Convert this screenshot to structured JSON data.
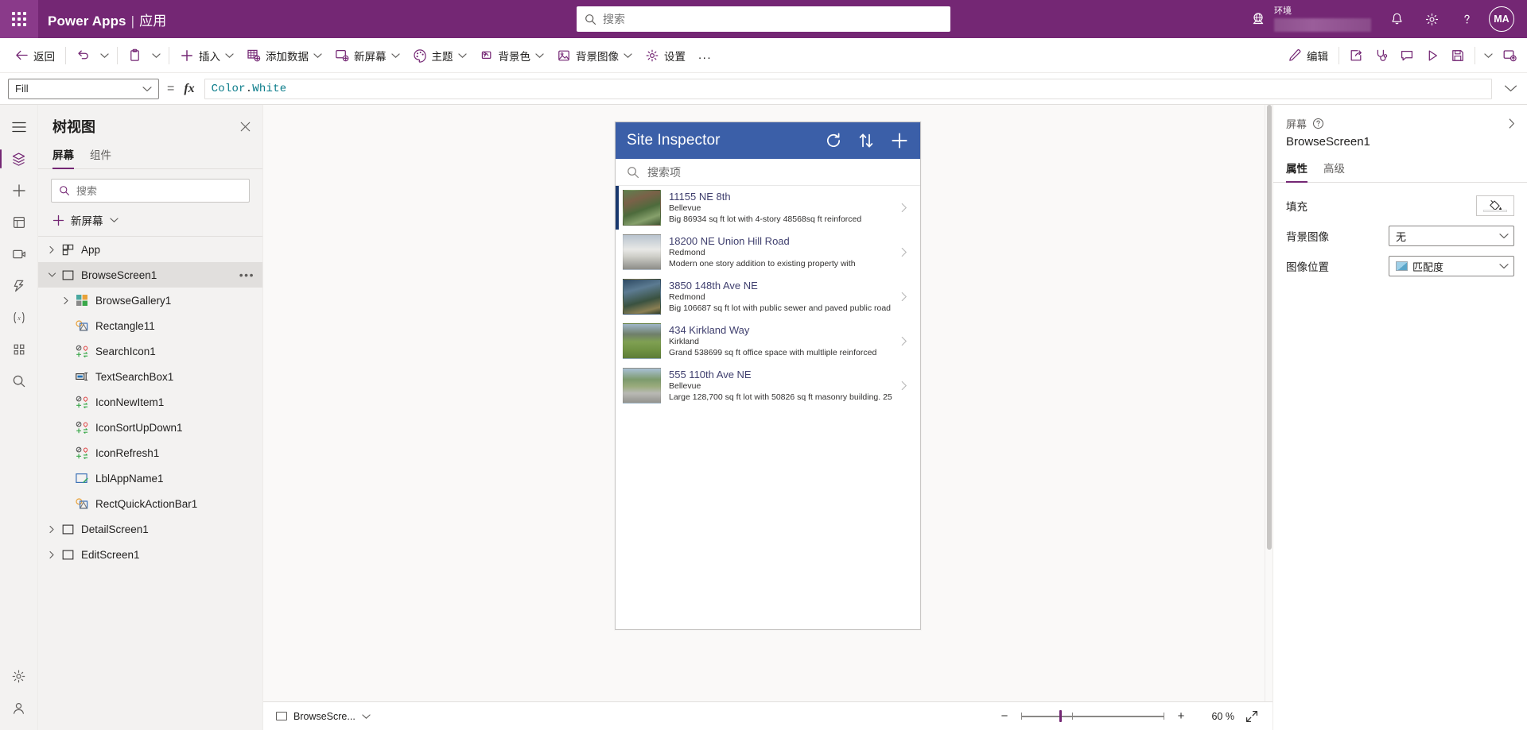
{
  "suitebar": {
    "waffle_title": "应用启动器",
    "brand": "Power Apps",
    "brand_separator": "|",
    "brand_sub": "应用",
    "search_placeholder": "搜索",
    "environment_label": "环境",
    "environment_value": "",
    "notifications_title": "通知",
    "settings_title": "设置",
    "help_title": "帮助",
    "avatar_initials": "MA",
    "accent_color": "#742774"
  },
  "ribbon": {
    "back_label": "返回",
    "undo_title": "撤消",
    "paste_title": "粘贴",
    "insert_label": "插入",
    "add_data_label": "添加数据",
    "new_screen_label": "新屏幕",
    "theme_label": "主题",
    "background_color_label": "背景色",
    "background_image_label": "背景图像",
    "settings_label": "设置",
    "more_label": "...",
    "edit_label": "编辑",
    "share_title": "共享",
    "app_checker_title": "应用检查器",
    "comments_title": "注释",
    "preview_title": "预览应用",
    "save_title": "保存",
    "publish_title": "发布"
  },
  "formulabar": {
    "property": "Fill",
    "equals": "=",
    "fx": "fx",
    "formula_object": "Color",
    "formula_dot": ".",
    "formula_member": "White",
    "expand_title": "展开公式栏"
  },
  "rail": {
    "items": [
      {
        "name": "hamburger",
        "title": "菜单"
      },
      {
        "name": "tree-view",
        "title": "树视图"
      },
      {
        "name": "insert",
        "title": "插入"
      },
      {
        "name": "data",
        "title": "数据"
      },
      {
        "name": "media",
        "title": "媒体"
      },
      {
        "name": "power-automate",
        "title": "Power Automate"
      },
      {
        "name": "variables",
        "title": "变量"
      },
      {
        "name": "components",
        "title": "组件"
      },
      {
        "name": "search",
        "title": "搜索"
      },
      {
        "name": "settings",
        "title": "设置"
      },
      {
        "name": "account",
        "title": "账户"
      }
    ]
  },
  "treepanel": {
    "title": "树视图",
    "close_title": "关闭",
    "tabs": [
      {
        "label": "屏幕",
        "active": true
      },
      {
        "label": "组件",
        "active": false
      }
    ],
    "search_placeholder": "搜索",
    "new_screen_label": "新屏幕",
    "nodes": [
      {
        "label": "App",
        "indent": 0,
        "chevron": "right",
        "icon": "app-icon",
        "selected": false,
        "more": false
      },
      {
        "label": "BrowseScreen1",
        "indent": 0,
        "chevron": "down",
        "icon": "screen-icon",
        "selected": true,
        "more": true
      },
      {
        "label": "BrowseGallery1",
        "indent": 1,
        "chevron": "right",
        "icon": "gallery-icon",
        "selected": false,
        "more": false
      },
      {
        "label": "Rectangle11",
        "indent": 1,
        "chevron": "none",
        "icon": "shape-icon",
        "selected": false,
        "more": false
      },
      {
        "label": "SearchIcon1",
        "indent": 1,
        "chevron": "none",
        "icon": "control-icon",
        "selected": false,
        "more": false
      },
      {
        "label": "TextSearchBox1",
        "indent": 1,
        "chevron": "none",
        "icon": "textinput-icon",
        "selected": false,
        "more": false
      },
      {
        "label": "IconNewItem1",
        "indent": 1,
        "chevron": "none",
        "icon": "control-icon",
        "selected": false,
        "more": false
      },
      {
        "label": "IconSortUpDown1",
        "indent": 1,
        "chevron": "none",
        "icon": "control-icon",
        "selected": false,
        "more": false
      },
      {
        "label": "IconRefresh1",
        "indent": 1,
        "chevron": "none",
        "icon": "control-icon",
        "selected": false,
        "more": false
      },
      {
        "label": "LblAppName1",
        "indent": 1,
        "chevron": "none",
        "icon": "label-icon",
        "selected": false,
        "more": false
      },
      {
        "label": "RectQuickActionBar1",
        "indent": 1,
        "chevron": "none",
        "icon": "shape-icon",
        "selected": false,
        "more": false
      },
      {
        "label": "DetailScreen1",
        "indent": 0,
        "chevron": "right",
        "icon": "screen-icon",
        "selected": false,
        "more": false
      },
      {
        "label": "EditScreen1",
        "indent": 0,
        "chevron": "right",
        "icon": "screen-icon",
        "selected": false,
        "more": false
      }
    ]
  },
  "canvas": {
    "app": {
      "header_title": "Site Inspector",
      "header_color": "#3b5fa8",
      "refresh_title": "刷新",
      "sort_title": "排序",
      "add_title": "新增",
      "search_placeholder": "搜索项",
      "items": [
        {
          "title": "11155 NE 8th",
          "city": "Bellevue",
          "description": "Big 86934 sq ft lot with 4-story 48568sq ft reinforced",
          "selected": true,
          "thumb": "t1"
        },
        {
          "title": "18200 NE Union Hill Road",
          "city": "Redmond",
          "description": "Modern one story addition to existing property with",
          "selected": false,
          "thumb": "t2"
        },
        {
          "title": "3850 148th Ave NE",
          "city": "Redmond",
          "description": "Big 106687 sq ft lot with public sewer and paved public road",
          "selected": false,
          "thumb": "t3"
        },
        {
          "title": "434 Kirkland Way",
          "city": "Kirkland",
          "description": "Grand 538699 sq ft office space with multliple reinforced",
          "selected": false,
          "thumb": "t4"
        },
        {
          "title": "555 110th Ave NE",
          "city": "Bellevue",
          "description": "Large 128,700 sq ft lot with 50826 sq ft masonry building. 25",
          "selected": false,
          "thumb": "t5"
        }
      ]
    }
  },
  "statusbar": {
    "screen_name": "BrowseScre...",
    "zoom_out_label": "−",
    "zoom_in_label": "+",
    "zoom_value": "60",
    "zoom_unit": "%",
    "fit_title": "适应屏幕"
  },
  "properties": {
    "kind_label": "屏幕",
    "help_title": "帮助",
    "collapse_title": "折叠",
    "control_name": "BrowseScreen1",
    "tabs": [
      {
        "label": "属性",
        "active": true
      },
      {
        "label": "高级",
        "active": false
      }
    ],
    "rows": [
      {
        "label": "填充",
        "kind": "color",
        "value": ""
      },
      {
        "label": "背景图像",
        "kind": "dropdown",
        "value": "无",
        "has_preview": false
      },
      {
        "label": "图像位置",
        "kind": "dropdown",
        "value": "匹配度",
        "has_preview": true
      }
    ]
  }
}
